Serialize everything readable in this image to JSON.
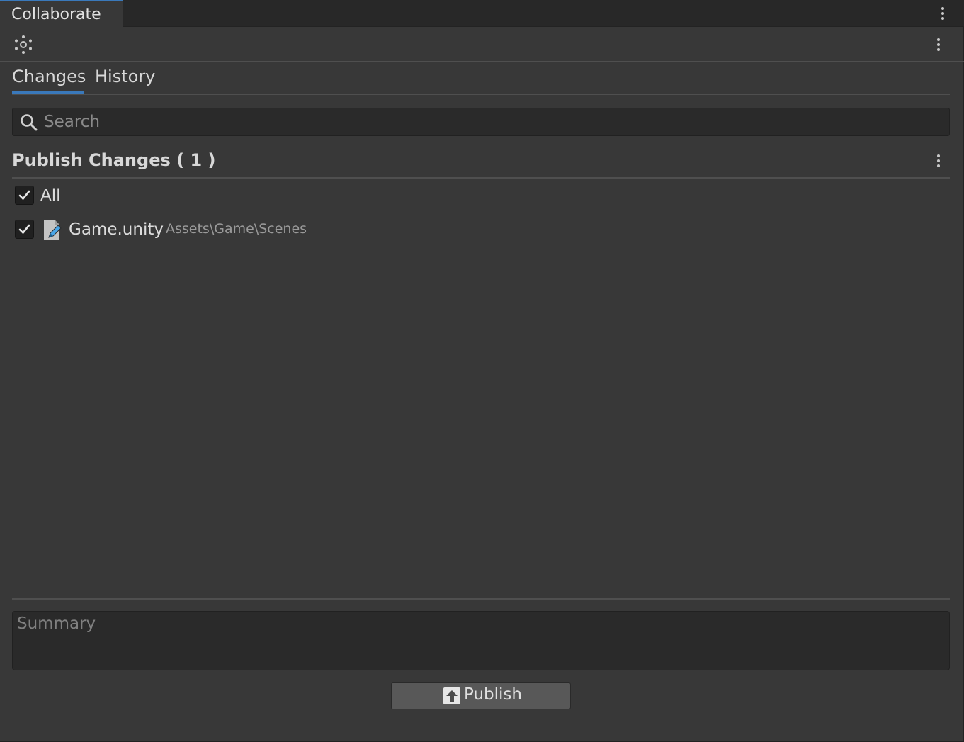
{
  "window": {
    "tab_title": "Collaborate"
  },
  "tabs": [
    {
      "label": "Changes",
      "active": true
    },
    {
      "label": "History",
      "active": false
    }
  ],
  "search": {
    "placeholder": "Search",
    "value": ""
  },
  "section": {
    "title": "Publish Changes ( 1 )"
  },
  "select_all": {
    "label": "All",
    "checked": true
  },
  "changes": [
    {
      "name": "Game.unity",
      "path": "Assets\\Game\\Scenes",
      "checked": true,
      "icon": "edited-file-icon"
    }
  ],
  "summary": {
    "placeholder": "Summary",
    "value": ""
  },
  "publish": {
    "label": "Publish",
    "icon": "upload-arrow-icon"
  },
  "colors": {
    "accent": "#3a79bb",
    "background": "#383838",
    "field": "#2a2a2a",
    "edit_icon": "#4aa6e8"
  }
}
